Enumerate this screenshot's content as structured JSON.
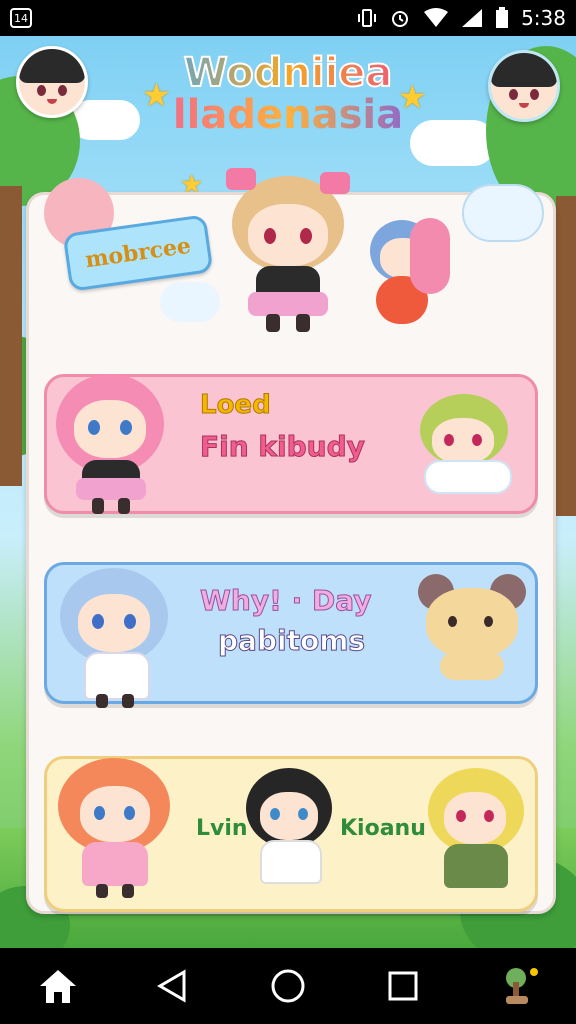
{
  "status_bar": {
    "time": "5:38",
    "icons": [
      "app-notification-icon",
      "vibrate-icon",
      "alarm-icon",
      "wifi-icon",
      "signal-icon",
      "battery-icon"
    ]
  },
  "header": {
    "title_line1": "Wodniiea",
    "title_line2": "lladenasia",
    "left_avatar": "profile-avatar",
    "right_avatar": "friend-avatar"
  },
  "badge": {
    "label": "mobrcee"
  },
  "cards": [
    {
      "id": "pink",
      "line1": "Loed",
      "line2": "Fin kibudy"
    },
    {
      "id": "blue",
      "line1": "Why! · Day",
      "line2": "pabitoms"
    },
    {
      "id": "yellow",
      "left_label": "Lvin",
      "right_label": "Kioanu"
    }
  ],
  "nav": {
    "items": [
      "home-icon",
      "back-icon",
      "circle-home-icon",
      "recents-icon",
      "app-shortcut-icon"
    ]
  },
  "colors": {
    "pink_card": "#fbc4d3",
    "blue_card": "#bfe0fb",
    "yellow_card": "#fdf1c8",
    "panel": "#fbf7f4"
  }
}
